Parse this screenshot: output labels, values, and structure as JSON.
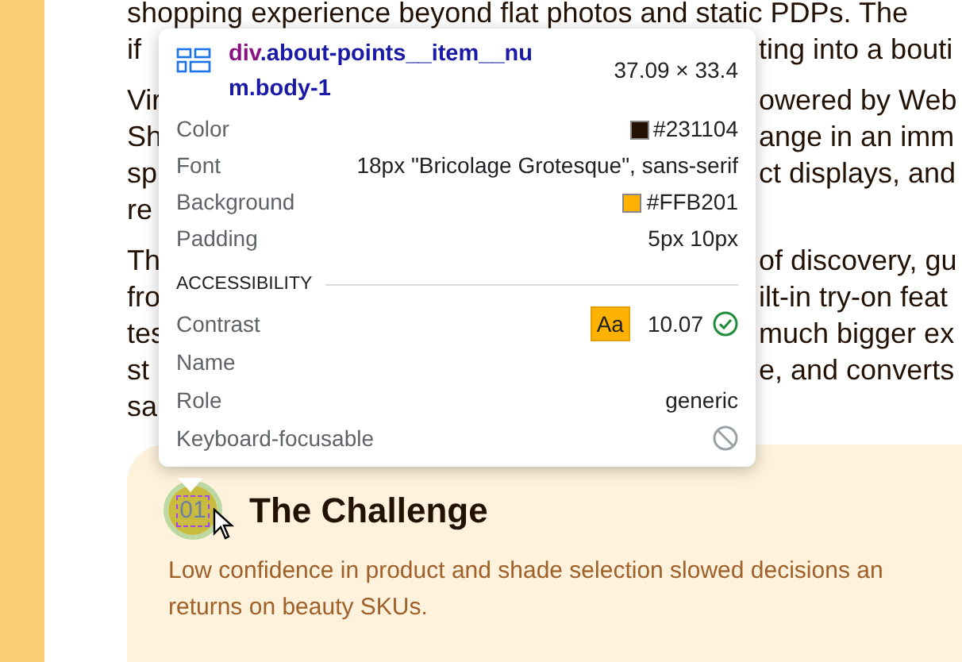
{
  "page": {
    "paragraphs": [
      {
        "lines": [
          {
            "left": "shopping experience beyond flat photos and static PDPs. The"
          },
          {
            "left": "if",
            "right": "ting into a bouti"
          }
        ]
      },
      {
        "lines": [
          {
            "left": "Vir",
            "right": "owered by Web"
          },
          {
            "left": "Sh",
            "right": "ange in an imm"
          },
          {
            "left": "sp",
            "right": "ct displays, and"
          },
          {
            "left": "re"
          }
        ]
      },
      {
        "lines": [
          {
            "left": "Th",
            "right": "of discovery, gu"
          },
          {
            "left": "fro",
            "right": "ilt-in try-on feat"
          },
          {
            "left": "tes",
            "right": "much bigger ex"
          },
          {
            "left": "st",
            "right": "e, and converts"
          },
          {
            "left": "sa"
          }
        ]
      }
    ]
  },
  "card": {
    "number": "01",
    "title": "The Challenge",
    "description_lines": [
      "Low confidence in product and shade selection slowed decisions an",
      "returns on beauty SKUs."
    ]
  },
  "inspector": {
    "tag": "div",
    "selector": ".about-points__item__num.body-1",
    "size": "37.09 × 33.4",
    "properties": [
      {
        "label": "Color",
        "value": "#231104",
        "kind": "color"
      },
      {
        "label": "Font",
        "value": "18px \"Bricolage Grotesque\", sans-serif",
        "kind": "text"
      },
      {
        "label": "Background",
        "value": "#FFB201",
        "kind": "color"
      },
      {
        "label": "Padding",
        "value": "5px 10px",
        "kind": "text"
      }
    ],
    "accessibility": {
      "heading": "ACCESSIBILITY",
      "contrast_label": "Contrast",
      "contrast_sample": "Aa",
      "contrast_ratio": "10.07",
      "contrast_pass": true,
      "name_label": "Name",
      "role_label": "Role",
      "role": "generic",
      "focusable_label": "Keyboard-focusable",
      "focusable": false
    }
  }
}
